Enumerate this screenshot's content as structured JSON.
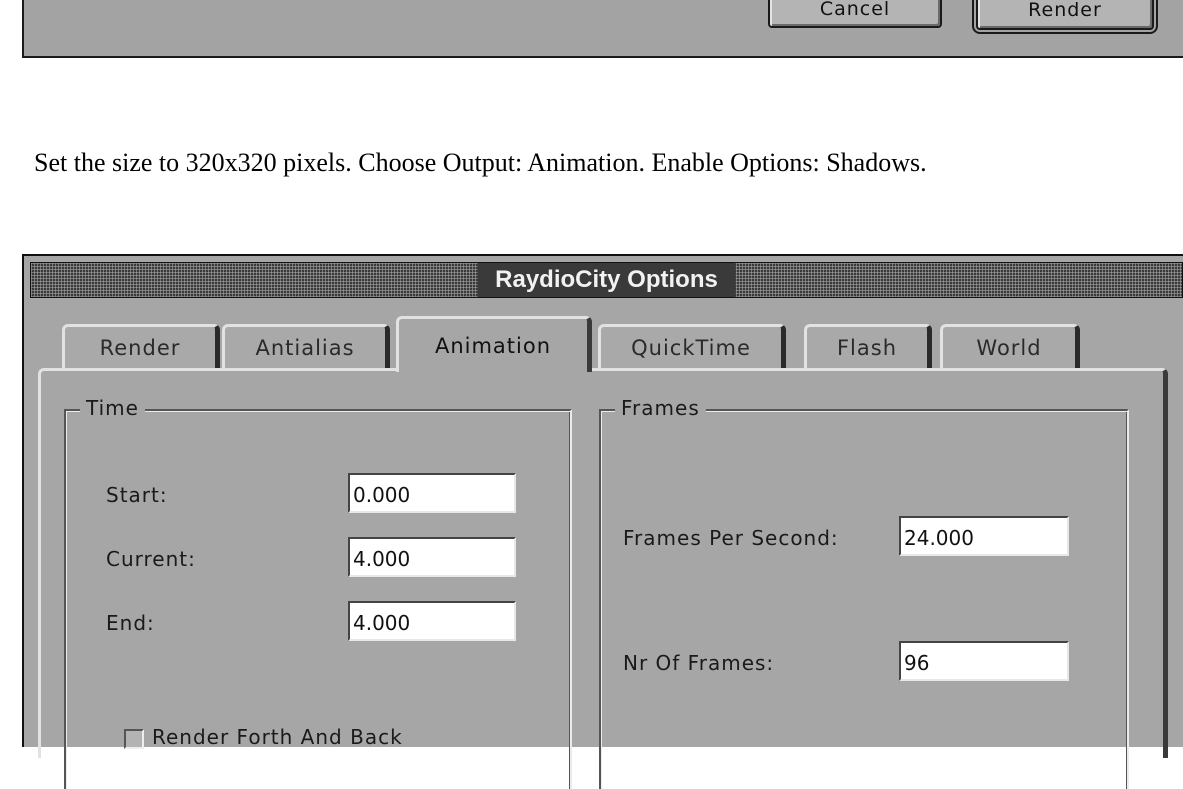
{
  "top_dialog": {
    "cancel_label": "Cancel",
    "render_label": "Render"
  },
  "instruction": "Set the size to 320x320 pixels. Choose Output: Animation. Enable Options: Shadows.",
  "dialog": {
    "title": "RaydioCity Options",
    "tabs": [
      {
        "label": "Render",
        "active": false
      },
      {
        "label": "Antialias",
        "active": false
      },
      {
        "label": "Animation",
        "active": true
      },
      {
        "label": "QuickTime",
        "active": false
      },
      {
        "label": "Flash",
        "active": false
      },
      {
        "label": "World",
        "active": false
      }
    ],
    "time_group": {
      "label": "Time",
      "start_label": "Start:",
      "start_value": "0.000",
      "current_label": "Current:",
      "current_value": "4.000",
      "end_label": "End:",
      "end_value": "4.000",
      "render_forth_back_label": "Render Forth And Back",
      "render_forth_back_checked": false
    },
    "frames_group": {
      "label": "Frames",
      "fps_label": "Frames Per Second:",
      "fps_value": "24.000",
      "nr_frames_label": "Nr Of Frames:",
      "nr_frames_value": "96"
    }
  }
}
